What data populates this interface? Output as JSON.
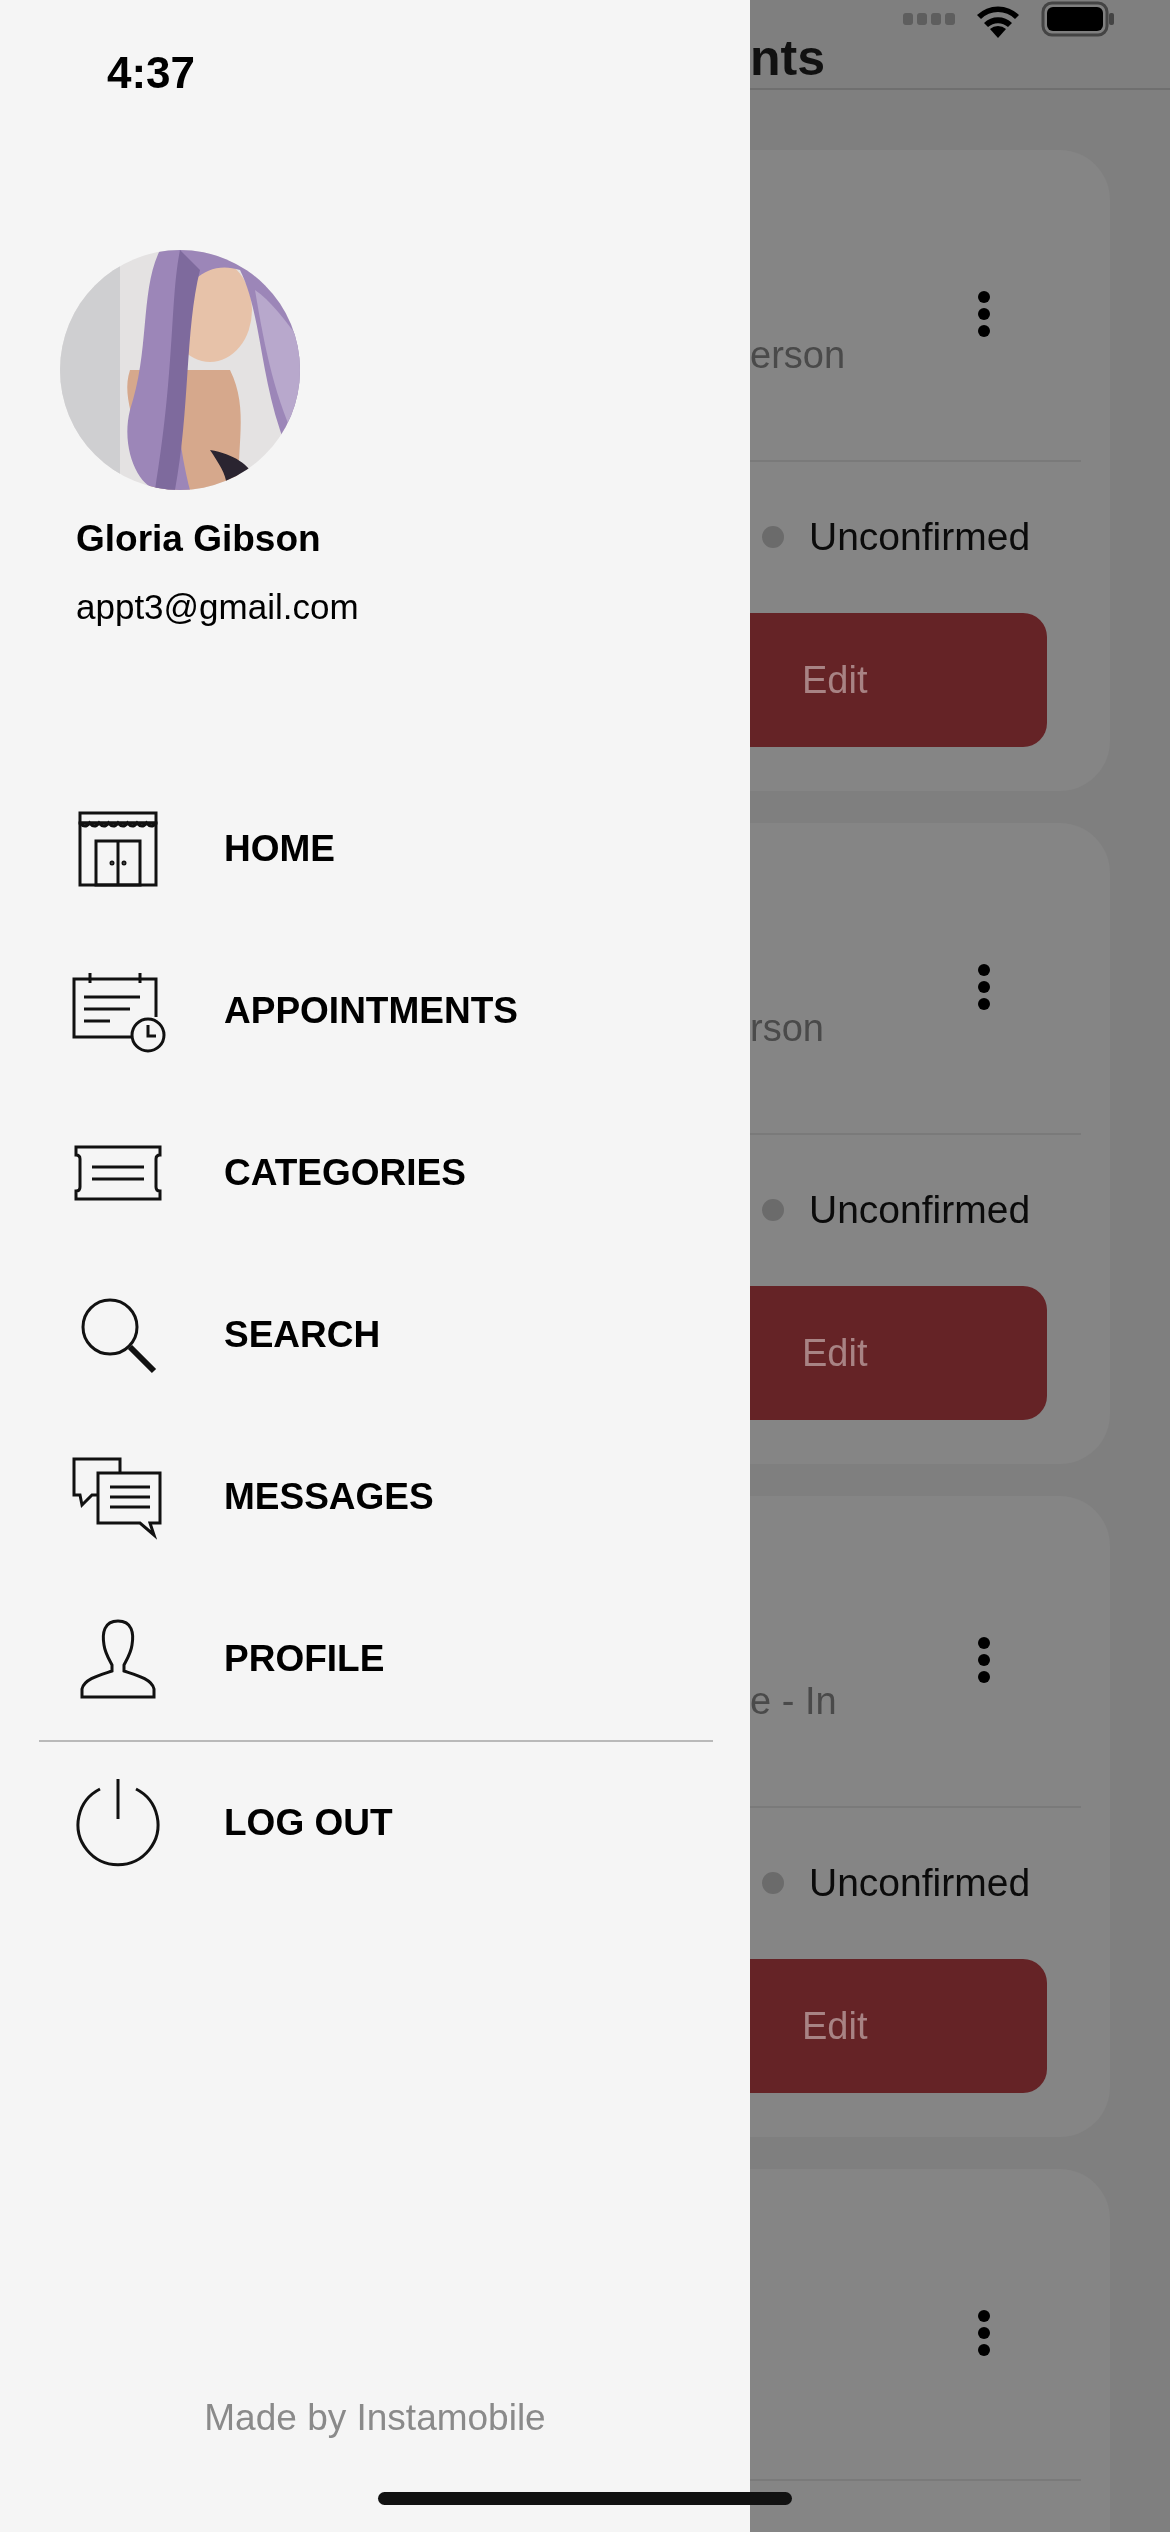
{
  "status_bar": {
    "time": "4:37"
  },
  "drawer": {
    "user": {
      "name": "Gloria Gibson",
      "email": "appt3@gmail.com"
    },
    "menu": [
      {
        "label": "HOME"
      },
      {
        "label": "APPOINTMENTS"
      },
      {
        "label": "CATEGORIES"
      },
      {
        "label": "SEARCH"
      },
      {
        "label": "MESSAGES"
      },
      {
        "label": "PROFILE"
      }
    ],
    "logout": {
      "label": "LOG OUT"
    },
    "footer": "Made by Instamobile"
  },
  "page": {
    "title": "nts",
    "cards": [
      {
        "subtitle": "erson",
        "status": "Unconfirmed",
        "button": "Edit"
      },
      {
        "subtitle": "rson",
        "status": "Unconfirmed",
        "button": "Edit"
      },
      {
        "subtitle": "e - In",
        "status": "Unconfirmed",
        "button": "Edit"
      }
    ]
  }
}
